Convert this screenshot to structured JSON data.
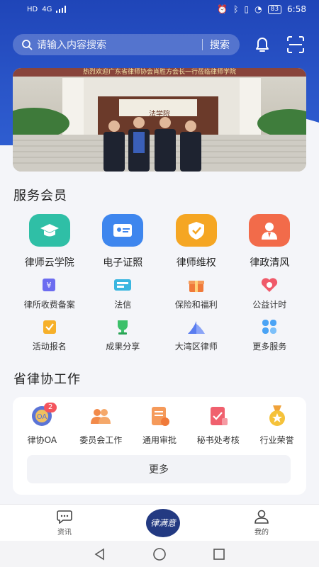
{
  "status": {
    "time": "6:58",
    "battery": "83",
    "network": "4G"
  },
  "search": {
    "placeholder": "请输入内容搜索",
    "button": "搜索"
  },
  "header_icons": [
    "bell-icon",
    "scan-icon"
  ],
  "banner": {
    "caption": "热烈欢迎广东省律师协会肖胜方会长一行莅临律师学院",
    "building_sign": "法学院"
  },
  "service": {
    "title": "服务会员",
    "primary": [
      {
        "label": "律师云学院",
        "icon": "graduation-cap-icon",
        "color": "#2fbfa6"
      },
      {
        "label": "电子证照",
        "icon": "id-card-icon",
        "color": "#3e86ee"
      },
      {
        "label": "律师维权",
        "icon": "shield-check-icon",
        "color": "#f5a623"
      },
      {
        "label": "律政清风",
        "icon": "lawyer-person-icon",
        "color": "#f26b4a"
      }
    ],
    "secondary_row1": [
      {
        "label": "律所收费备案",
        "icon": "fee-record-icon"
      },
      {
        "label": "法信",
        "icon": "faxin-icon"
      },
      {
        "label": "保险和福利",
        "icon": "gift-icon"
      },
      {
        "label": "公益计时",
        "icon": "heart-clock-icon"
      }
    ],
    "secondary_row2": [
      {
        "label": "活动报名",
        "icon": "signup-icon"
      },
      {
        "label": "成果分享",
        "icon": "trophy-icon"
      },
      {
        "label": "大湾区律师",
        "icon": "bay-area-icon"
      },
      {
        "label": "更多服务",
        "icon": "more-grid-icon"
      }
    ]
  },
  "work": {
    "title": "省律协工作",
    "items": [
      {
        "label": "律协OA",
        "icon": "oa-icon",
        "badge": "2"
      },
      {
        "label": "委员会工作",
        "icon": "committee-icon"
      },
      {
        "label": "通用审批",
        "icon": "approval-icon"
      },
      {
        "label": "秘书处考核",
        "icon": "assessment-icon"
      },
      {
        "label": "行业荣誉",
        "icon": "medal-icon"
      }
    ],
    "more": "更多"
  },
  "tabbar": {
    "news": "资讯",
    "logo": "律满意",
    "mine": "我的"
  },
  "colors": {
    "header": "#1f45b8",
    "badge": "#f4545d",
    "logo_bg": "#233a82"
  }
}
